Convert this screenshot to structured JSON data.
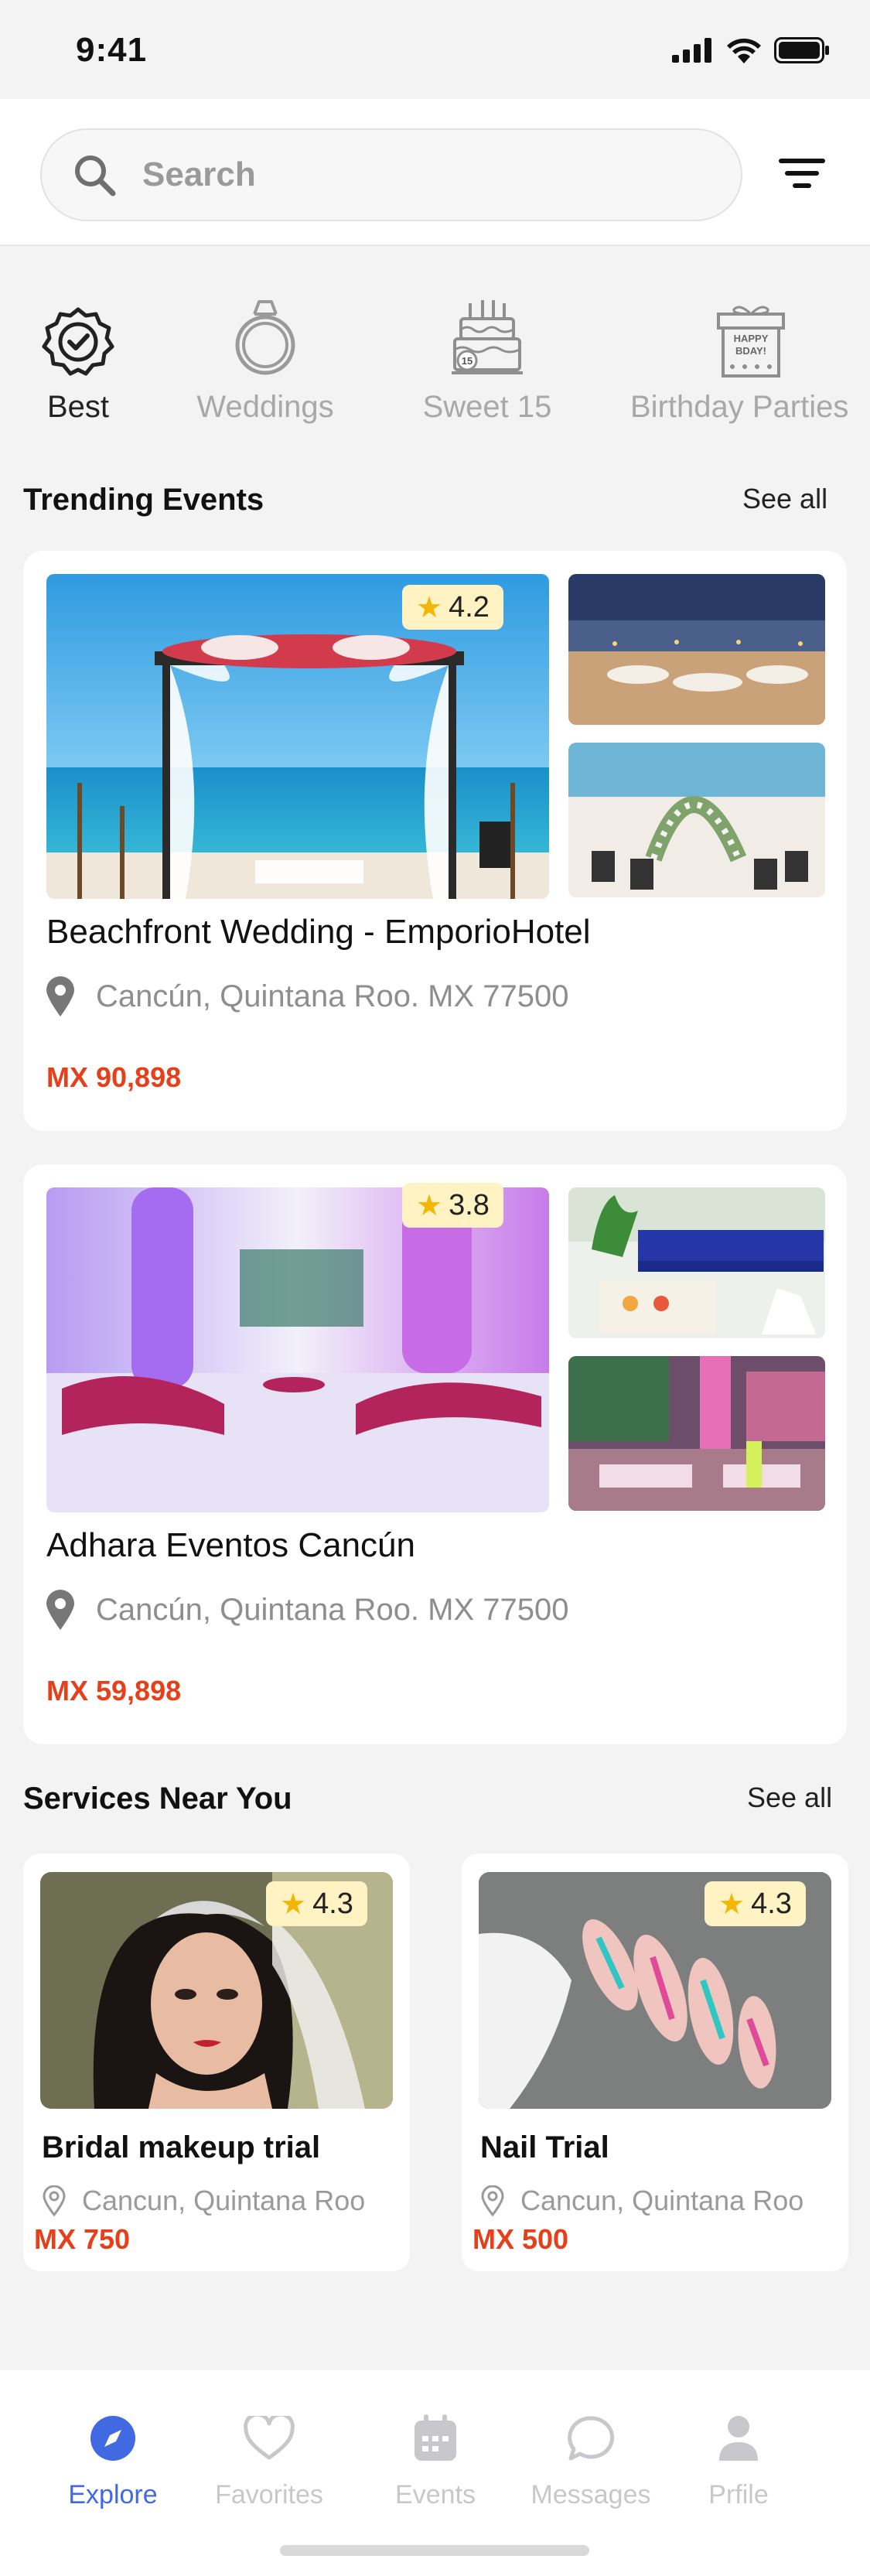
{
  "status_bar": {
    "time": "9:41"
  },
  "search": {
    "placeholder": "Search"
  },
  "categories": [
    {
      "label": "Best",
      "active": true,
      "icon": "badge-check-icon"
    },
    {
      "label": "Weddings",
      "active": false,
      "icon": "ring-icon"
    },
    {
      "label": "Sweet 15",
      "active": false,
      "icon": "cake-icon"
    },
    {
      "label": "Birthday Parties",
      "active": false,
      "icon": "gift-box-icon"
    }
  ],
  "trending": {
    "title": "Trending Events",
    "see_all": "See all",
    "events": [
      {
        "rating": "4.2",
        "title": "Beachfront Wedding - EmporioHotel",
        "location": "Cancún, Quintana Roo. MX 77500",
        "price": "MX 90,898"
      },
      {
        "rating": "3.8",
        "title": "Adhara Eventos Cancún",
        "location": "Cancún, Quintana Roo. MX 77500",
        "price": "MX 59,898"
      }
    ]
  },
  "services": {
    "title": "Services Near You",
    "see_all": "See all",
    "items": [
      {
        "rating": "4.3",
        "title": "Bridal makeup trial",
        "location": "Cancun, Quintana Roo",
        "price": "MX 750"
      },
      {
        "rating": "4.3",
        "title": "Nail Trial",
        "location": "Cancun, Quintana Roo",
        "price": "MX 500"
      }
    ]
  },
  "nav": {
    "items": [
      {
        "label": "Explore",
        "icon": "compass-icon",
        "active": true
      },
      {
        "label": "Favorites",
        "icon": "heart-icon",
        "active": false
      },
      {
        "label": "Events",
        "icon": "calendar-icon",
        "active": false
      },
      {
        "label": "Messages",
        "icon": "chat-icon",
        "active": false
      },
      {
        "label": "Prfile",
        "icon": "person-icon",
        "active": false
      }
    ]
  },
  "colors": {
    "accent": "#4169E1",
    "price": "#E5401A",
    "rating_bg": "#FFF3C4",
    "star": "#F2B705"
  }
}
